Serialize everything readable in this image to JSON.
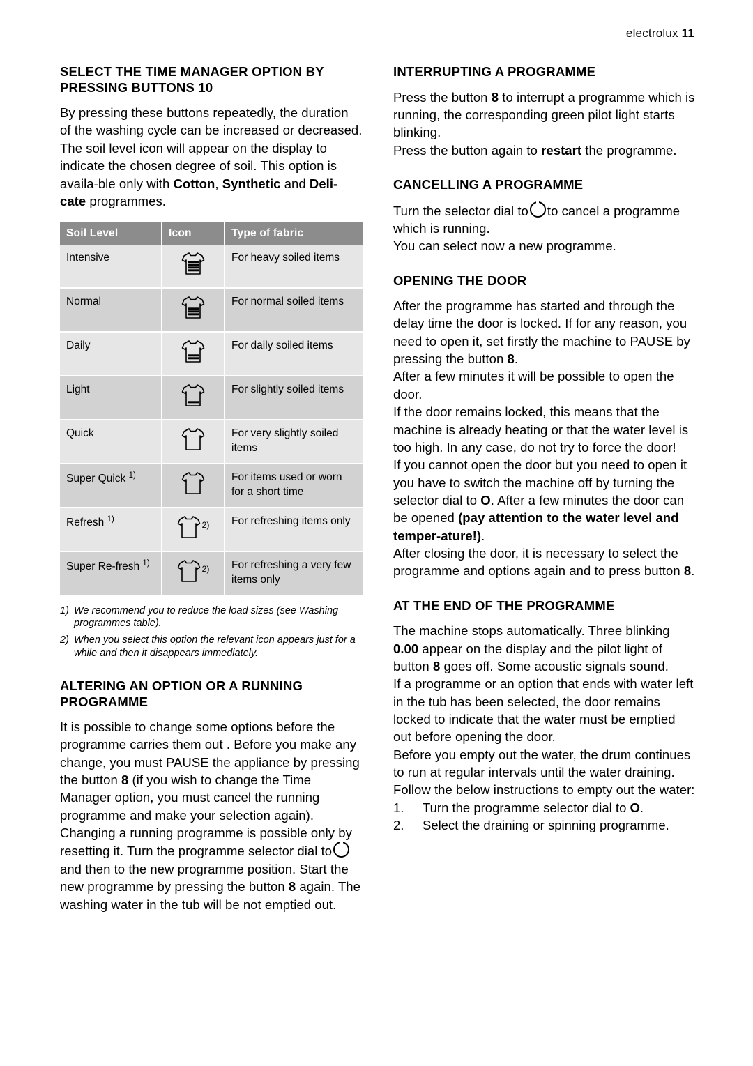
{
  "header": {
    "brand": "electrolux",
    "page": "11"
  },
  "left": {
    "heading1": "SELECT THE TIME MANAGER OPTION BY PRESSING BUTTONS 10",
    "para1_a": "By pressing these buttons repeatedly, the duration of the washing cycle can be increased or decreased. The soil level icon will appear on the display to indicate the chosen degree of soil. This option is availa-ble only with ",
    "para1_b": "Cotton",
    "para1_c": ", ",
    "para1_d": "Synthetic",
    "para1_e": " and ",
    "para1_f": "Deli-cate",
    "para1_g": " programmes.",
    "table": {
      "headers": [
        "Soil Level",
        "Icon",
        "Type of fabric"
      ],
      "rows": [
        {
          "level": "Intensive",
          "level_sup": "",
          "icon": "shirt-full",
          "icon_sup": "",
          "fabric": "For heavy soiled items"
        },
        {
          "level": "Normal",
          "level_sup": "",
          "icon": "shirt-3",
          "icon_sup": "",
          "fabric": "For normal soiled items"
        },
        {
          "level": "Daily",
          "level_sup": "",
          "icon": "shirt-2",
          "icon_sup": "",
          "fabric": "For daily soiled items"
        },
        {
          "level": "Light",
          "level_sup": "",
          "icon": "shirt-1",
          "icon_sup": "",
          "fabric": "For slightly soiled items"
        },
        {
          "level": "Quick",
          "level_sup": "",
          "icon": "shirt-0",
          "icon_sup": "",
          "fabric": "For very slightly soiled items"
        },
        {
          "level": "Super Quick",
          "level_sup": "1)",
          "icon": "shirt-empty",
          "icon_sup": "",
          "fabric": "For items used or worn for a short time"
        },
        {
          "level": "Refresh",
          "level_sup": "1)",
          "icon": "shirt-empty",
          "icon_sup": "2)",
          "fabric": "For refreshing items only"
        },
        {
          "level": "Super Re-fresh",
          "level_sup": "1)",
          "icon": "shirt-empty",
          "icon_sup": "2)",
          "fabric": "For refreshing a very few items only"
        }
      ]
    },
    "footnotes": [
      {
        "num": "1)",
        "text": "We recommend you to reduce the load sizes (see Washing programmes table)."
      },
      {
        "num": "2)",
        "text": "When you select this option the relevant icon appears just for a while and then it disappears immediately."
      }
    ],
    "heading2": "ALTERING AN OPTION OR A RUNNING PROGRAMME",
    "para2_a": "It is possible to change some options before the programme carries them out . Before you make any change, you must PAUSE the appliance by pressing the button ",
    "para2_b": "8",
    "para2_c": " (if you wish to change the Time Manager option, you must cancel the running programme and make your selection again).",
    "para3_a": "Changing a running programme is possible only by resetting it. Turn the programme selector dial to",
    "para3_b": "and then to the new programme position. Start the new programme by pressing the button ",
    "para3_c": "8",
    "para3_d": " again. The washing water in the tub will be not emptied out."
  },
  "right": {
    "heading1": "INTERRUPTING A PROGRAMME",
    "para1_a": "Press the button ",
    "para1_b": "8",
    "para1_c": " to interrupt a programme which is running, the corresponding green pilot light starts blinking.",
    "para2_a": "Press the button again to ",
    "para2_b": "restart",
    "para2_c": " the programme.",
    "heading2": "CANCELLING A PROGRAMME",
    "para3_a": "Turn the selector dial to",
    "para3_b": "to cancel a programme which is running.",
    "para4": "You can select now a new programme.",
    "heading3": "OPENING THE DOOR",
    "para5_a": "After the programme has started and through the delay time the door is locked. If for any reason, you need to open it, set firstly the machine to PAUSE by pressing the button ",
    "para5_b": "8",
    "para5_c": ".",
    "para6": "After a few minutes it will be possible to open the door.",
    "para7": "If the door remains locked, this means that the machine is already heating or that the water level is too high. In any case, do not try to force the door!",
    "para8_a": "If you cannot open the door but you need to open it you have to switch the machine off by turning the selector dial to ",
    "para8_b": "O",
    "para8_c": ". After a few minutes the door can be opened ",
    "para8_d": "(pay attention to the water level and temper-ature!)",
    "para8_e": ".",
    "para9_a": "After closing the door, it is necessary to select the programme and options again and to press button ",
    "para9_b": "8",
    "para9_c": ".",
    "heading4": "AT THE END OF THE PROGRAMME",
    "para10_a": "The machine stops automatically. Three blinking ",
    "para10_b": "0.00",
    "para10_c": " appear on the display and the pilot light of button ",
    "para10_d": "8",
    "para10_e": " goes off. Some acoustic signals sound.",
    "para11": "If a programme or an option that ends with water left in the tub has been selected, the door remains locked to indicate that the water must be emptied out before opening the door.",
    "para12": "Before you empty out the water, the drum continues to run at regular intervals until the water draining.",
    "para13": "Follow the below instructions to empty out the water:",
    "steps": [
      {
        "num": "1.",
        "text_a": "Turn the programme selector dial to ",
        "text_b": "O",
        "text_c": "."
      },
      {
        "num": "2.",
        "text_a": "Select the draining or spinning programme.",
        "text_b": "",
        "text_c": ""
      }
    ]
  }
}
